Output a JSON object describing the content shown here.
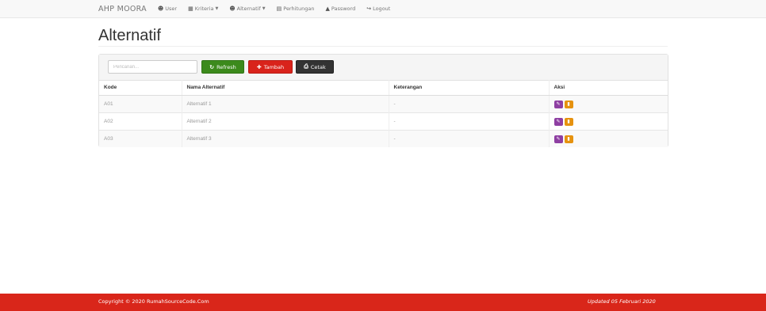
{
  "navbar": {
    "brand": "AHP MOORA",
    "items": [
      {
        "label": "User",
        "icon": "user-icon",
        "glyph": "☻",
        "dropdown": false
      },
      {
        "label": "Kriteria",
        "icon": "grid-icon",
        "glyph": "▦",
        "dropdown": true
      },
      {
        "label": "Alternatif",
        "icon": "user-icon",
        "glyph": "☻",
        "dropdown": true
      },
      {
        "label": "Perhitungan",
        "icon": "calculator-icon",
        "glyph": "▤",
        "dropdown": false
      },
      {
        "label": "Password",
        "icon": "lock-icon",
        "glyph": "▲",
        "dropdown": false
      },
      {
        "label": "Logout",
        "icon": "logout-icon",
        "glyph": "↪",
        "dropdown": false
      }
    ]
  },
  "page": {
    "title": "Alternatif"
  },
  "toolbar": {
    "search_placeholder": "Pencarian...",
    "refresh_label": "Refresh",
    "tambah_label": "Tambah",
    "cetak_label": "Cetak"
  },
  "table": {
    "headers": [
      "Kode",
      "Nama Alternatif",
      "Keterangan",
      "Aksi"
    ],
    "rows": [
      {
        "kode": "A01",
        "nama": "Alternatif 1",
        "keterangan": "-"
      },
      {
        "kode": "A02",
        "nama": "Alternatif 2",
        "keterangan": "-"
      },
      {
        "kode": "A03",
        "nama": "Alternatif 3",
        "keterangan": "-"
      }
    ]
  },
  "footer": {
    "copyright": "Copyright © 2020 RumahSourceCode.Com",
    "updated": "Updated 05 Februari 2020"
  },
  "colors": {
    "refresh": "#3c8a1c",
    "tambah": "#d9231b",
    "cetak": "#333333",
    "edit_action": "#8e3fa2",
    "delete_action": "#e6920f",
    "footer": "#d9261a"
  }
}
